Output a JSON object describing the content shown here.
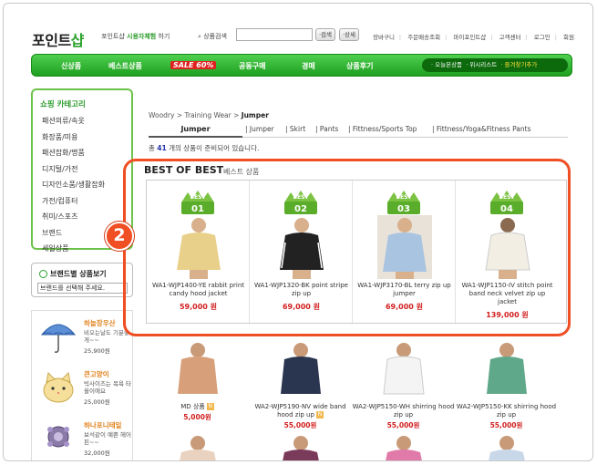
{
  "header": {
    "logo_main": "포인트",
    "logo_accent": "샵",
    "slogan_prefix": "포인트샵",
    "slogan_highlight": "시용자체험",
    "slogan_suffix": "하기",
    "search_label": "상품검색",
    "search_value": "",
    "search_button": "검색",
    "detail_button": "상세",
    "top_links": [
      "장바구니",
      "주문배송조회",
      "마이포인트샵",
      "고객센터",
      "로그인",
      "회원가입"
    ]
  },
  "nav": {
    "items": [
      "신상품",
      "베스트상품",
      "SALE 60%",
      "공동구매",
      "경매",
      "상품후기"
    ],
    "right_links": [
      "오늘본상품",
      "위시리스트",
      "즐겨찾기추가"
    ]
  },
  "sidebar": {
    "category_title": "쇼핑 카테고리",
    "categories": [
      "패션의류/속옷",
      "화장품/미용",
      "패션잡화/명품",
      "디지털/가전",
      "디자인소품/생활잡화",
      "가전/컴퓨터",
      "취미/스포츠",
      "브랜드",
      "세일상품"
    ],
    "brand_title": "브랜드별 상품보기",
    "brand_select": "브랜드를 선택해 주세요.",
    "promo_items": [
      {
        "name": "하늘장우산",
        "desc": "비오는날도 기분좋게~~",
        "price": "25,900원"
      },
      {
        "name": "큰고양이",
        "desc": "빅사이즈는 목욕 타올이에요",
        "price": "25,000원"
      },
      {
        "name": "하나포니테일",
        "desc": "보석같이 예쁜 헤어핀~~",
        "price": "32,000원"
      }
    ]
  },
  "main": {
    "breadcrumb_path": "Woodry > Training Wear > ",
    "breadcrumb_current": "Jumper",
    "tabs": [
      "Jumper",
      "Jumper",
      "Skirt",
      "Pants",
      "Fittness/Sports Top",
      "Fittness/Yoga&Fitness Pants"
    ],
    "count_prefix": "총",
    "count": "41",
    "count_suffix": "개의 상품이 준비되어 있습니다.",
    "best_title": "BEST OF BEST",
    "best_subtitle": "베스트 상품",
    "step_badge": "2",
    "best_products": [
      {
        "rank": "01",
        "label": "BEST",
        "name": "WA1-WJP1400-YE rabbit print candy hood jacket",
        "price": "59,000 원",
        "color": "#e8d08a"
      },
      {
        "rank": "02",
        "label": "BEST",
        "name": "WA1-WJP1320-BK point stripe zip up",
        "price": "69,000 원",
        "color": "#222222"
      },
      {
        "rank": "03",
        "label": "BEST",
        "name": "WA1-WJP3170-BL terry zip up jumper",
        "price": "69,000 원",
        "color": "#a9c4e0"
      },
      {
        "rank": "04",
        "label": "BEST",
        "name": "WA1-WJP1150-IV stitch point band neck velvet zip up jacket",
        "price": "139,000 원",
        "color": "#f2eee4"
      }
    ],
    "grid_products": [
      {
        "name": "MD 상품",
        "tag": "N",
        "price": "5,000원",
        "color": "#d7a07a"
      },
      {
        "name": "WA2-WJP5190-NV wide band hood zip up",
        "tag": "N",
        "price": "55,000원",
        "color": "#2a3550"
      },
      {
        "name": "WA2-WJP5150-WH shirring hood zip up",
        "tag": "",
        "price": "55,000원",
        "color": "#f4f4f4"
      },
      {
        "name": "WA2-WJP5150-KK shirring hood zip up",
        "tag": "",
        "price": "55,000원",
        "color": "#5fa88a"
      }
    ],
    "grid_row2_colors": [
      "#e9d2bf",
      "#7a3a5a",
      "#e07aa8",
      "#c8d8e8"
    ]
  }
}
